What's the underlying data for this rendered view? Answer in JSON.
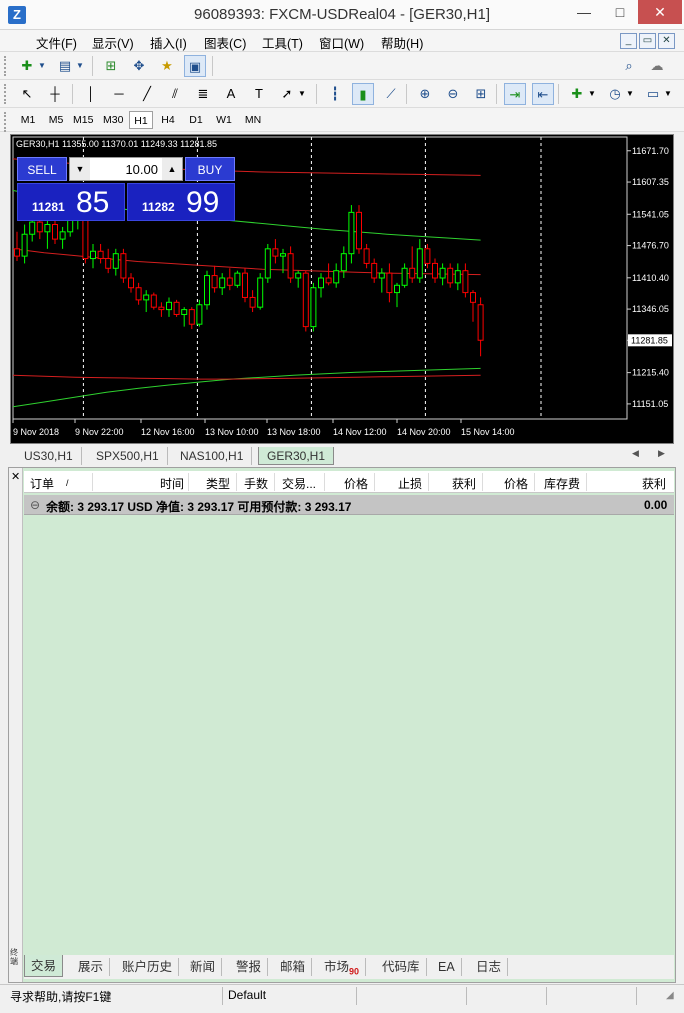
{
  "window": {
    "title": "96089393: FXCM-USDReal04 - [GER30,H1]",
    "controls": {
      "minimize": "—",
      "restore": "□",
      "close": "✕"
    }
  },
  "menu": {
    "items": [
      "文件(F)",
      "显示(V)",
      "插入(I)",
      "图表(C)",
      "工具(T)",
      "窗口(W)",
      "帮助(H)"
    ],
    "mdi": {
      "minimize": "_",
      "restore": "▭",
      "close": "✕"
    }
  },
  "timeframes": [
    "M1",
    "M5",
    "M15",
    "M30",
    "H1",
    "H4",
    "D1",
    "W1",
    "MN"
  ],
  "active_timeframe": "H1",
  "chart": {
    "info": "GER30,H1  11355.00 11370.01 11249.33 11281.85",
    "trade_panel": {
      "sell_label": "SELL",
      "buy_label": "BUY",
      "lot": "10.00",
      "sell_small": "11281",
      "sell_big": "85",
      "buy_small": "11282",
      "buy_big": "99"
    },
    "colors": {
      "bull": "#00ff00",
      "bear": "#ff0000",
      "ma_red": "#d41f1f",
      "ma_green": "#2fd12f",
      "bg": "#000000"
    }
  },
  "chart_data": {
    "type": "candlestick",
    "symbol": "GER30",
    "timeframe": "H1",
    "ylim": [
      11120,
      11700
    ],
    "y_ticks": [
      "11671.70",
      "11607.35",
      "11541.05",
      "11476.70",
      "11410.40",
      "11346.05",
      "11281.85",
      "11215.40",
      "11151.05"
    ],
    "current_price": "11281.85",
    "x_ticks": [
      "9 Nov 2018",
      "9 Nov 22:00",
      "12 Nov 16:00",
      "13 Nov 10:00",
      "13 Nov 18:00",
      "14 Nov 12:00",
      "14 Nov 20:00",
      "15 Nov 14:00"
    ],
    "candles": [
      {
        "o": 11470,
        "h": 11505,
        "l": 11445,
        "c": 11455
      },
      {
        "o": 11455,
        "h": 11520,
        "l": 11440,
        "c": 11500
      },
      {
        "o": 11500,
        "h": 11560,
        "l": 11485,
        "c": 11525
      },
      {
        "o": 11525,
        "h": 11545,
        "l": 11490,
        "c": 11505
      },
      {
        "o": 11505,
        "h": 11535,
        "l": 11470,
        "c": 11520
      },
      {
        "o": 11520,
        "h": 11540,
        "l": 11480,
        "c": 11490
      },
      {
        "o": 11490,
        "h": 11515,
        "l": 11470,
        "c": 11505
      },
      {
        "o": 11505,
        "h": 11545,
        "l": 11495,
        "c": 11530
      },
      {
        "o": 11530,
        "h": 11570,
        "l": 11510,
        "c": 11555
      },
      {
        "o": 11555,
        "h": 11600,
        "l": 11440,
        "c": 11450
      },
      {
        "o": 11450,
        "h": 11480,
        "l": 11430,
        "c": 11465
      },
      {
        "o": 11465,
        "h": 11480,
        "l": 11440,
        "c": 11450
      },
      {
        "o": 11450,
        "h": 11470,
        "l": 11420,
        "c": 11430
      },
      {
        "o": 11430,
        "h": 11470,
        "l": 11415,
        "c": 11460
      },
      {
        "o": 11460,
        "h": 11470,
        "l": 11400,
        "c": 11410
      },
      {
        "o": 11410,
        "h": 11420,
        "l": 11380,
        "c": 11390
      },
      {
        "o": 11390,
        "h": 11400,
        "l": 11355,
        "c": 11365
      },
      {
        "o": 11365,
        "h": 11385,
        "l": 11340,
        "c": 11375
      },
      {
        "o": 11375,
        "h": 11380,
        "l": 11345,
        "c": 11350
      },
      {
        "o": 11350,
        "h": 11360,
        "l": 11330,
        "c": 11345
      },
      {
        "o": 11345,
        "h": 11370,
        "l": 11330,
        "c": 11360
      },
      {
        "o": 11360,
        "h": 11365,
        "l": 11330,
        "c": 11335
      },
      {
        "o": 11335,
        "h": 11350,
        "l": 11310,
        "c": 11345
      },
      {
        "o": 11345,
        "h": 11350,
        "l": 11305,
        "c": 11315
      },
      {
        "o": 11315,
        "h": 11365,
        "l": 11310,
        "c": 11355
      },
      {
        "o": 11355,
        "h": 11425,
        "l": 11345,
        "c": 11415
      },
      {
        "o": 11415,
        "h": 11435,
        "l": 11380,
        "c": 11390
      },
      {
        "o": 11390,
        "h": 11420,
        "l": 11375,
        "c": 11410
      },
      {
        "o": 11410,
        "h": 11430,
        "l": 11385,
        "c": 11395
      },
      {
        "o": 11395,
        "h": 11425,
        "l": 11390,
        "c": 11420
      },
      {
        "o": 11420,
        "h": 11430,
        "l": 11360,
        "c": 11370
      },
      {
        "o": 11370,
        "h": 11385,
        "l": 11340,
        "c": 11350
      },
      {
        "o": 11350,
        "h": 11420,
        "l": 11345,
        "c": 11410
      },
      {
        "o": 11410,
        "h": 11480,
        "l": 11400,
        "c": 11470
      },
      {
        "o": 11470,
        "h": 11490,
        "l": 11440,
        "c": 11455
      },
      {
        "o": 11455,
        "h": 11470,
        "l": 11420,
        "c": 11460
      },
      {
        "o": 11460,
        "h": 11475,
        "l": 11400,
        "c": 11410
      },
      {
        "o": 11410,
        "h": 11425,
        "l": 11390,
        "c": 11420
      },
      {
        "o": 11420,
        "h": 11425,
        "l": 11300,
        "c": 11310
      },
      {
        "o": 11310,
        "h": 11400,
        "l": 11300,
        "c": 11390
      },
      {
        "o": 11390,
        "h": 11420,
        "l": 11370,
        "c": 11410
      },
      {
        "o": 11410,
        "h": 11440,
        "l": 11395,
        "c": 11400
      },
      {
        "o": 11400,
        "h": 11440,
        "l": 11390,
        "c": 11425
      },
      {
        "o": 11425,
        "h": 11475,
        "l": 11410,
        "c": 11460
      },
      {
        "o": 11460,
        "h": 11560,
        "l": 11440,
        "c": 11545
      },
      {
        "o": 11545,
        "h": 11560,
        "l": 11460,
        "c": 11470
      },
      {
        "o": 11470,
        "h": 11480,
        "l": 11430,
        "c": 11440
      },
      {
        "o": 11440,
        "h": 11450,
        "l": 11400,
        "c": 11410
      },
      {
        "o": 11410,
        "h": 11430,
        "l": 11380,
        "c": 11420
      },
      {
        "o": 11420,
        "h": 11440,
        "l": 11360,
        "c": 11380
      },
      {
        "o": 11380,
        "h": 11400,
        "l": 11350,
        "c": 11395
      },
      {
        "o": 11395,
        "h": 11440,
        "l": 11390,
        "c": 11430
      },
      {
        "o": 11430,
        "h": 11475,
        "l": 11400,
        "c": 11410
      },
      {
        "o": 11410,
        "h": 11490,
        "l": 11400,
        "c": 11470
      },
      {
        "o": 11470,
        "h": 11480,
        "l": 11430,
        "c": 11440
      },
      {
        "o": 11440,
        "h": 11450,
        "l": 11400,
        "c": 11410
      },
      {
        "o": 11410,
        "h": 11440,
        "l": 11395,
        "c": 11430
      },
      {
        "o": 11430,
        "h": 11440,
        "l": 11390,
        "c": 11400
      },
      {
        "o": 11400,
        "h": 11440,
        "l": 11385,
        "c": 11425
      },
      {
        "o": 11425,
        "h": 11440,
        "l": 11370,
        "c": 11380
      },
      {
        "o": 11380,
        "h": 11385,
        "l": 11320,
        "c": 11360
      },
      {
        "o": 11355,
        "h": 11370,
        "l": 11249,
        "c": 11282
      }
    ],
    "ma_lines": [
      {
        "color": "red",
        "values": [
          11655,
          11650,
          11645,
          11640,
          11637,
          11635,
          11632,
          11630,
          11628,
          11627,
          11626,
          11625,
          11624,
          11623,
          11622,
          11621
        ]
      },
      {
        "color": "green",
        "values": [
          11590,
          11578,
          11566,
          11556,
          11548,
          11540,
          11534,
          11528,
          11522,
          11516,
          11510,
          11505,
          11500,
          11496,
          11492,
          11488
        ]
      },
      {
        "color": "red",
        "values": [
          11470,
          11462,
          11456,
          11450,
          11444,
          11440,
          11436,
          11432,
          11428,
          11426,
          11424,
          11422,
          11420,
          11419,
          11418,
          11417
        ]
      },
      {
        "color": "green",
        "values": [
          11145,
          11155,
          11165,
          11175,
          11183,
          11190,
          11196,
          11202,
          11206,
          11210,
          11213,
          11216,
          11218,
          11220,
          11222,
          11224
        ]
      },
      {
        "color": "red",
        "values": [
          11210,
          11208,
          11206,
          11205,
          11204,
          11203,
          11202,
          11202,
          11203,
          11204,
          11205,
          11206,
          11207,
          11208,
          11209,
          11210
        ]
      }
    ]
  },
  "chart_tabs": [
    "US30,H1",
    "SPX500,H1",
    "NAS100,H1",
    "GER30,H1"
  ],
  "active_chart_tab": "GER30,H1",
  "terminal": {
    "side_label": "终端",
    "columns": [
      "订单",
      "/",
      "时间",
      "类型",
      "手数",
      "交易...",
      "价格",
      "止损",
      "获利",
      "价格",
      "库存费",
      "获利"
    ],
    "balance_row": {
      "icon": "⊖",
      "text": "余额: 3 293.17 USD  净值: 3 293.17  可用预付款: 3 293.17",
      "profit": "0.00"
    },
    "tabs": [
      "交易",
      "展示",
      "账户历史",
      "新闻",
      "警报",
      "邮箱",
      "市场",
      "代码库",
      "EA",
      "日志"
    ],
    "market_badge": "90",
    "active_tab": "交易"
  },
  "status": {
    "help": "寻求帮助,请按F1键",
    "profile": "Default"
  }
}
